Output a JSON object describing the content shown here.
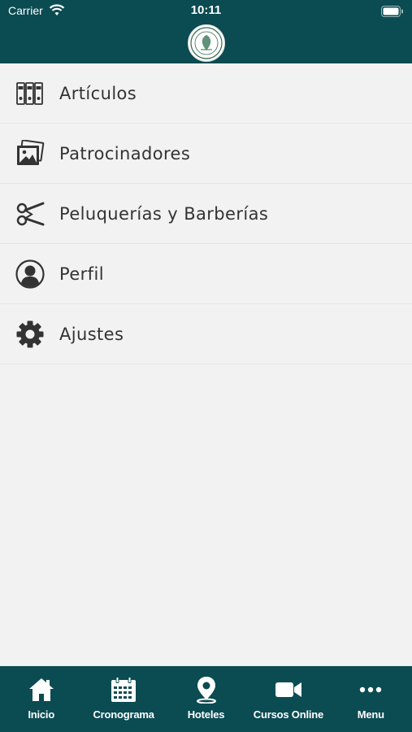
{
  "status_bar": {
    "carrier": "Carrier",
    "time": "10:11",
    "icons": [
      "wifi-icon",
      "battery-icon"
    ]
  },
  "header": {
    "logo": "seal-logo"
  },
  "menu": {
    "items": [
      {
        "label": "Artículos",
        "icon": "binders-icon"
      },
      {
        "label": "Patrocinadores",
        "icon": "photos-icon"
      },
      {
        "label": "Peluquerías y Barberías",
        "icon": "scissors-icon"
      },
      {
        "label": "Perfil",
        "icon": "user-circle-icon"
      },
      {
        "label": "Ajustes",
        "icon": "gear-icon"
      }
    ]
  },
  "tabbar": {
    "tabs": [
      {
        "label": "Inicio",
        "icon": "home-icon"
      },
      {
        "label": "Cronograma",
        "icon": "calendar-icon"
      },
      {
        "label": "Hoteles",
        "icon": "map-pin-icon"
      },
      {
        "label": "Cursos Online",
        "icon": "video-camera-icon"
      },
      {
        "label": "Menu",
        "icon": "more-dots-icon"
      }
    ]
  },
  "colors": {
    "primary": "#0b4b52",
    "background": "#f2f2f2",
    "text": "#333333"
  }
}
